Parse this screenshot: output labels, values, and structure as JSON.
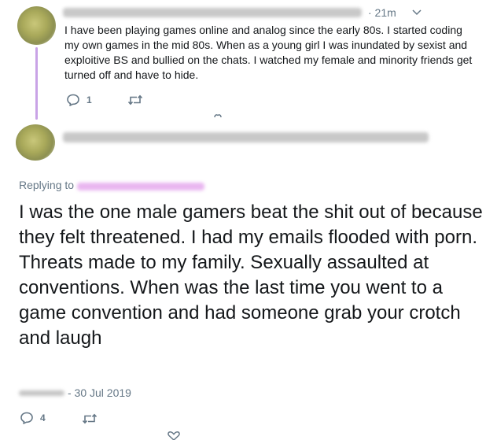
{
  "tweet1": {
    "time": "· 21m",
    "text": "I have been playing games online and analog since the early 80s. I started coding my own games in the mid 80s. When as a young girl I was inundated by sexist and exploitive BS and bullied on the chats. I watched my female and minority friends get turned off and have to hide.",
    "reply_count": "1"
  },
  "tweet2": {
    "replying_prefix": "Replying to",
    "text": "I was the one male gamers beat the shit out of because they felt threatened. I had my emails flooded with porn. Threats made to my family. Sexually assaulted at conventions. When was the last time you went to a game convention and had someone grab your crotch and laugh",
    "date": "- 30 Jul 2019",
    "reply_count": "4"
  },
  "icons": {
    "reply": "reply-icon",
    "retweet": "retweet-icon",
    "like": "heart-icon",
    "more": "chevron-down-icon"
  },
  "colors": {
    "thread_line": "#c9a3e6",
    "mention_blur": "#e9b6f0",
    "secondary_text": "#657786",
    "icon": "#657786"
  }
}
